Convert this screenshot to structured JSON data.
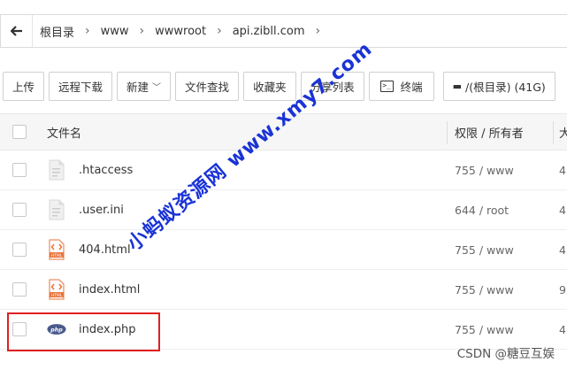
{
  "breadcrumb": {
    "items": [
      "根目录",
      "www",
      "wwwroot",
      "api.zibll.com"
    ]
  },
  "toolbar": {
    "upload": "上传",
    "remote_download": "远程下载",
    "new": "新建",
    "file_search": "文件查找",
    "favorites": "收藏夹",
    "share_list": "分享列表",
    "terminal": "终端",
    "disk": "/(根目录) (41G)"
  },
  "table": {
    "headers": {
      "name": "文件名",
      "perm": "权限 / 所有者",
      "size": "大"
    },
    "rows": [
      {
        "name": ".htaccess",
        "perm": "755 / www",
        "size": "4",
        "icon": "generic-file-icon"
      },
      {
        "name": ".user.ini",
        "perm": "644 / root",
        "size": "4",
        "icon": "generic-file-icon"
      },
      {
        "name": "404.html",
        "perm": "755 / www",
        "size": "4",
        "icon": "html-file-icon"
      },
      {
        "name": "index.html",
        "perm": "755 / www",
        "size": "9",
        "icon": "html-file-icon"
      },
      {
        "name": "index.php",
        "perm": "755 / www",
        "size": "4",
        "icon": "php-file-icon"
      }
    ]
  },
  "watermark": "小蚂蚁资源网 www.xmy7.com",
  "credit": "CSDN @糖豆互娱",
  "colors": {
    "highlight": "#e02020",
    "watermark": "#1a33d6",
    "html_icon": "#e8733a",
    "php_icon": "#4a5a8c"
  }
}
